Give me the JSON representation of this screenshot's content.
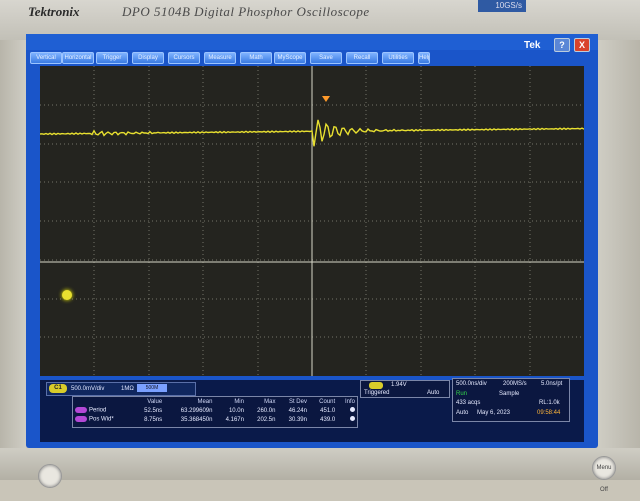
{
  "bezel": {
    "brand": "Tektronix",
    "model": "DPO 5104B Digital Phosphor Oscilloscope",
    "badge": "10GS/s",
    "knob_left": "",
    "knob_right": "Menu Off"
  },
  "menubar": {
    "items": [
      "Vertical",
      "Horizontal",
      "Trigger",
      "Display",
      "Cursors",
      "Measure",
      "Math",
      "MyScope",
      "Save",
      "Recall",
      "Utilities",
      "Help"
    ],
    "logo": "Tek",
    "help_btn": "?",
    "close_btn": "X"
  },
  "channel": {
    "tag": "C1",
    "scale": "500.0mV/div",
    "impedance": "1MΩ",
    "bw_tag": "500M"
  },
  "measurements": {
    "headers": [
      "",
      "Value",
      "Mean",
      "Min",
      "Max",
      "St Dev",
      "Count",
      "Info"
    ],
    "rows": [
      {
        "label": "Period",
        "value": "52.5ns",
        "mean": "63.299609n",
        "min": "10.0n",
        "max": "260.0n",
        "stdev": "46.24n",
        "count": "451.0"
      },
      {
        "label": "Pos Wid*",
        "value": "8.75ns",
        "mean": "35.368450n",
        "min": "4.167n",
        "max": "202.5n",
        "stdev": "30.39n",
        "count": "439.0"
      }
    ]
  },
  "trigger": {
    "tag": "C1",
    "level": "1.94V",
    "state": "Triggered",
    "mode": "Auto"
  },
  "acquisition": {
    "timebase": "500.0ns/div",
    "sample_rate": "200MS/s",
    "resolution": "5.0ns/pt",
    "run_state": "Run",
    "sample_mode": "Sample",
    "acqs": "433 acqs",
    "record_length": "RL:1.0k",
    "trigger_mode": "Auto",
    "date": "May 6, 2023",
    "time": "09:58:44"
  },
  "colors": {
    "trace": "#e8e030",
    "screen_frame": "#1a55c9",
    "grid": "#b8b8a8",
    "run": "#34d74a",
    "time": "#ffb63a"
  }
}
